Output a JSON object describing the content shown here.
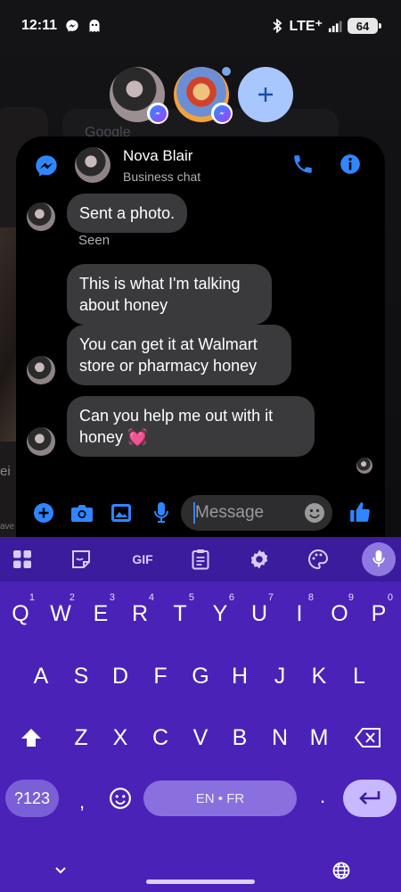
{
  "status_bar": {
    "time": "12:11",
    "network": "LTE⁺",
    "battery": "64"
  },
  "background": {
    "google_text": "Google",
    "left_text": "ei",
    "left_caption": "ave"
  },
  "chat": {
    "name": "Nova Blair",
    "subtitle": "Business chat",
    "messages": [
      {
        "text": "Sent a photo."
      },
      {
        "text": "This is what I'm talking about honey"
      },
      {
        "text": "You can get it at Walmart store or pharmacy honey"
      },
      {
        "text": "Can you help me out with it honey 💓"
      }
    ],
    "seen_label": "Seen",
    "message_placeholder": "Message"
  },
  "keyboard": {
    "toolbar": [
      "apps-icon",
      "sticker-icon",
      "gif",
      "clipboard-icon",
      "settings-icon",
      "palette-icon",
      "mic-icon"
    ],
    "gif_label": "GIF",
    "row1": [
      {
        "letter": "Q",
        "hint": "1"
      },
      {
        "letter": "W",
        "hint": "2"
      },
      {
        "letter": "E",
        "hint": "3"
      },
      {
        "letter": "R",
        "hint": "4"
      },
      {
        "letter": "T",
        "hint": "5"
      },
      {
        "letter": "Y",
        "hint": "6"
      },
      {
        "letter": "U",
        "hint": "7"
      },
      {
        "letter": "I",
        "hint": "8"
      },
      {
        "letter": "O",
        "hint": "9"
      },
      {
        "letter": "P",
        "hint": "0"
      }
    ],
    "row2": [
      "A",
      "S",
      "D",
      "F",
      "G",
      "H",
      "J",
      "K",
      "L"
    ],
    "row3": [
      "Z",
      "X",
      "C",
      "V",
      "B",
      "N",
      "M"
    ],
    "symbols_label": "?123",
    "comma": ",",
    "period": ".",
    "space_label": "EN • FR"
  },
  "colors": {
    "messenger_blue": "#2f86ff",
    "keyboard_bg": "#4a22b8",
    "bubble_bg": "#3a3a3c"
  }
}
